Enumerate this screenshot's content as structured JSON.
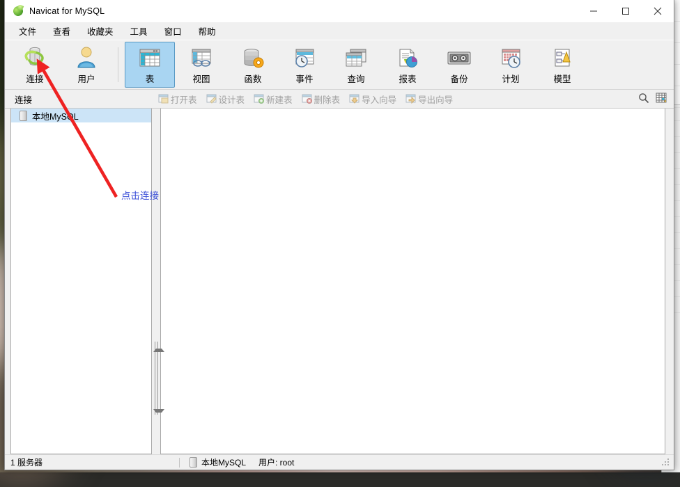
{
  "window": {
    "title": "Navicat for MySQL",
    "app_icon": "navicat-leaf-icon",
    "minimize": "–",
    "maximize": "□",
    "close": "✕"
  },
  "menubar": {
    "items": [
      {
        "label": "文件",
        "name": "menu-file"
      },
      {
        "label": "查看",
        "name": "menu-view"
      },
      {
        "label": "收藏夹",
        "name": "menu-favorites"
      },
      {
        "label": "工具",
        "name": "menu-tools"
      },
      {
        "label": "窗口",
        "name": "menu-window"
      },
      {
        "label": "帮助",
        "name": "menu-help"
      }
    ]
  },
  "toolbar": {
    "groups": [
      {
        "buttons": [
          {
            "label": "连接",
            "icon": "connection-icon",
            "selected": false
          },
          {
            "label": "用户",
            "icon": "user-icon",
            "selected": false
          }
        ]
      },
      {
        "buttons": [
          {
            "label": "表",
            "icon": "table-icon",
            "selected": true
          },
          {
            "label": "视图",
            "icon": "view-icon",
            "selected": false
          },
          {
            "label": "函数",
            "icon": "function-icon",
            "selected": false
          },
          {
            "label": "事件",
            "icon": "event-icon",
            "selected": false
          },
          {
            "label": "查询",
            "icon": "query-icon",
            "selected": false
          },
          {
            "label": "报表",
            "icon": "report-icon",
            "selected": false
          },
          {
            "label": "备份",
            "icon": "backup-icon",
            "selected": false
          },
          {
            "label": "计划",
            "icon": "schedule-icon",
            "selected": false
          },
          {
            "label": "模型",
            "icon": "model-icon",
            "selected": false
          }
        ]
      }
    ]
  },
  "subtoolbar": {
    "panel_label": "连接",
    "buttons": [
      {
        "label": "打开表",
        "icon": "open-table-icon",
        "enabled": false
      },
      {
        "label": "设计表",
        "icon": "design-table-icon",
        "enabled": false
      },
      {
        "label": "新建表",
        "icon": "new-table-icon",
        "enabled": false
      },
      {
        "label": "删除表",
        "icon": "delete-table-icon",
        "enabled": false
      },
      {
        "label": "导入向导",
        "icon": "import-wizard-icon",
        "enabled": false
      },
      {
        "label": "导出向导",
        "icon": "export-wizard-icon",
        "enabled": false
      }
    ],
    "right_icons": [
      {
        "name": "search-icon"
      },
      {
        "name": "grid-view-icon"
      }
    ]
  },
  "sidebar": {
    "items": [
      {
        "label": "本地MySQL",
        "icon": "server-icon",
        "selected": true
      }
    ]
  },
  "content": {
    "body": ""
  },
  "statusbar": {
    "left": "1 服务器",
    "connection": "本地MySQL",
    "user": "用户: root",
    "connection_icon": "server-icon",
    "resize_grip": "resize-grip-icon"
  },
  "annotation": {
    "text": "点击连接",
    "arrow_color": "#ee2222",
    "text_color": "#3b4fd8"
  },
  "colors": {
    "window_bg": "#f0f0f0",
    "selected_toolbar": "#a9d5f2",
    "selected_toolbar_border": "#5a9ac4",
    "tree_selection": "#cce4f7",
    "disabled_text": "#a0a0a0",
    "accent_blue": "#3b4fd8",
    "annotation_red": "#ee2222"
  }
}
